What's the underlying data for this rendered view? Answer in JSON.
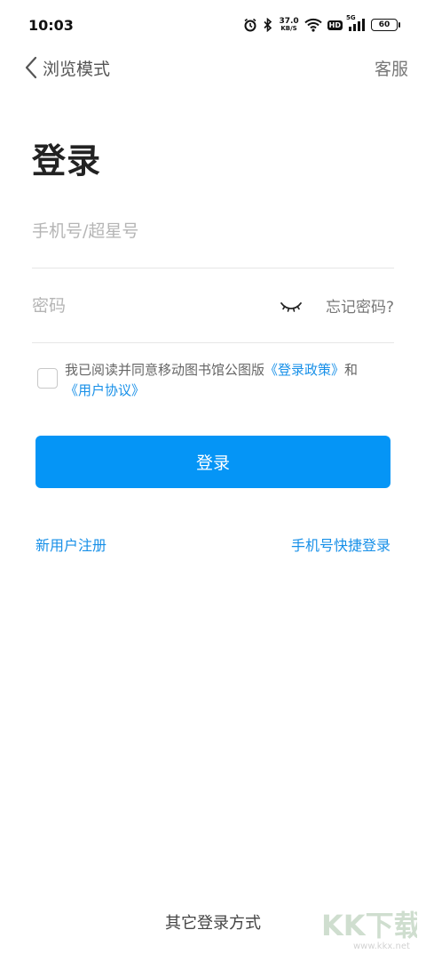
{
  "status_bar": {
    "time": "10:03",
    "net_speed_value": "37.0",
    "net_speed_unit": "KB/S",
    "hd_label": "HD",
    "network_label": "5G",
    "battery": "60",
    "icons": [
      "alarm-icon",
      "bluetooth-icon",
      "wifi-icon",
      "signal-icon",
      "battery-icon"
    ]
  },
  "nav": {
    "back_label": "浏览模式",
    "service_label": "客服"
  },
  "title": "登录",
  "form": {
    "phone_placeholder": "手机号/超星号",
    "password_placeholder": "密码",
    "forgot_label": "忘记密码?",
    "agreement_prefix": "我已阅读并同意移动图书馆公图版",
    "agreement_policy": "《登录政策》",
    "agreement_and": "和",
    "agreement_terms": "《用户协议》",
    "login_label": "登录"
  },
  "links": {
    "register": "新用户注册",
    "quick_login": "手机号快捷登录"
  },
  "other_login": "其它登录方式",
  "watermark": {
    "brand": "KK下载",
    "url": "www.kkx.net"
  },
  "colors": {
    "accent": "#0595f6",
    "link": "#1890e8"
  }
}
